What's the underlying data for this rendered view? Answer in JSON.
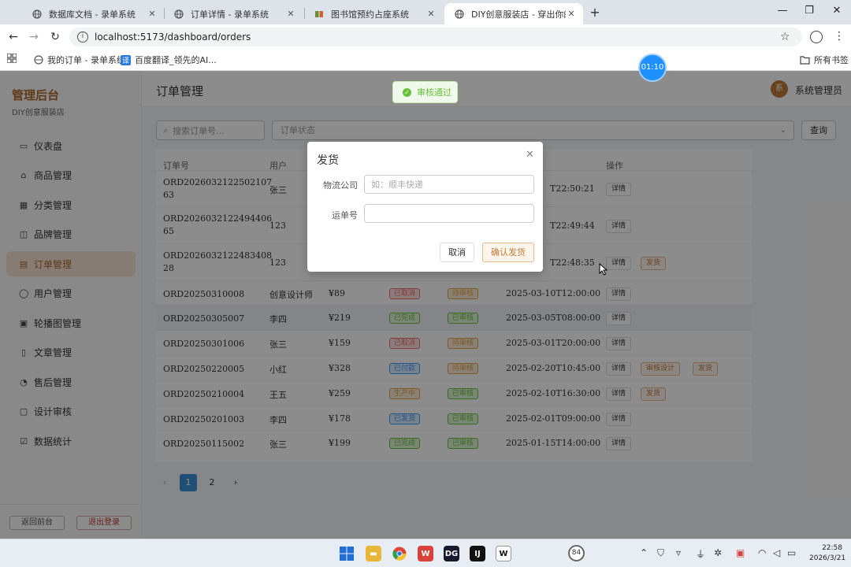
{
  "browser": {
    "tabs": [
      {
        "label": "数据库文档 - 录单系统",
        "active": false,
        "favicon": "globe-icon"
      },
      {
        "label": "订单详情 - 录单系统",
        "active": false,
        "favicon": "globe-icon"
      },
      {
        "label": "图书馆预约占座系统",
        "active": false,
        "favicon": "book-icon"
      },
      {
        "label": "DIY创意服装店 - 穿出你的故事",
        "active": true,
        "favicon": "globe-icon"
      }
    ],
    "url": "localhost:5173/dashboard/orders",
    "bookmarks": [
      {
        "label": "我的订单 - 录单系统"
      },
      {
        "label": "百度翻译_领先的AI..."
      }
    ],
    "all_bookmarks": "所有书签"
  },
  "sidebar": {
    "title": "管理后台",
    "subtitle": "DIY创意服装店",
    "items": [
      {
        "label": "仪表盘",
        "icon": "dashboard-icon"
      },
      {
        "label": "商品管理",
        "icon": "bag-icon"
      },
      {
        "label": "分类管理",
        "icon": "grid-icon"
      },
      {
        "label": "品牌管理",
        "icon": "brand-icon"
      },
      {
        "label": "订单管理",
        "icon": "order-icon",
        "active": true
      },
      {
        "label": "用户管理",
        "icon": "user-icon"
      },
      {
        "label": "轮播图管理",
        "icon": "image-icon"
      },
      {
        "label": "文章管理",
        "icon": "article-icon"
      },
      {
        "label": "售后管理",
        "icon": "service-icon"
      },
      {
        "label": "设计审核",
        "icon": "review-icon"
      },
      {
        "label": "数据统计",
        "icon": "chart-icon"
      }
    ],
    "back_label": "返回前台",
    "logout_label": "退出登录"
  },
  "header": {
    "title": "订单管理",
    "avatar_text": "系",
    "admin_name": "系统管理员"
  },
  "toast": "审核通过",
  "filters": {
    "search_placeholder": "搜索订单号...",
    "status_placeholder": "订单状态",
    "query_label": "查询"
  },
  "table": {
    "headers": [
      "订单号",
      "用户",
      "",
      "",
      "",
      "",
      "操作"
    ],
    "rows": [
      {
        "order_no": "ORD2026032122502107\n63",
        "user": "张三",
        "amount": "",
        "status": "",
        "review": "",
        "time": "T22:50:21",
        "actions": [
          "详情"
        ]
      },
      {
        "order_no": "ORD2026032122494406\n65",
        "user": "123",
        "amount": "",
        "status": "",
        "review": "",
        "time": "T22:49:44",
        "actions": [
          "详情"
        ]
      },
      {
        "order_no": "ORD2026032122483408\n28",
        "user": "123",
        "amount": "",
        "status": "",
        "review": "",
        "time": "T22:48:35",
        "actions": [
          "详情",
          "发货"
        ]
      },
      {
        "order_no": "ORD20250310008",
        "user": "创意设计师",
        "amount": "¥89",
        "status": "已取消",
        "review": "待审核",
        "time": "2025-03-10T12:00:00",
        "actions": [
          "详情"
        ]
      },
      {
        "order_no": "ORD20250305007",
        "user": "李四",
        "amount": "¥219",
        "status": "已完成",
        "review": "已审核",
        "time": "2025-03-05T08:00:00",
        "actions": [
          "详情"
        ]
      },
      {
        "order_no": "ORD20250301006",
        "user": "张三",
        "amount": "¥159",
        "status": "已取消",
        "review": "待审核",
        "time": "2025-03-01T20:00:00",
        "actions": [
          "详情"
        ]
      },
      {
        "order_no": "ORD20250220005",
        "user": "小红",
        "amount": "¥328",
        "status": "已付款",
        "review": "待审核",
        "time": "2025-02-20T10:45:00",
        "actions": [
          "详情",
          "审核设计",
          "发货"
        ]
      },
      {
        "order_no": "ORD20250210004",
        "user": "王五",
        "amount": "¥259",
        "status": "生产中",
        "review": "已审核",
        "time": "2025-02-10T16:30:00",
        "actions": [
          "详情",
          "发货"
        ]
      },
      {
        "order_no": "ORD20250201003",
        "user": "李四",
        "amount": "¥178",
        "status": "已发货",
        "review": "已审核",
        "time": "2025-02-01T09:00:00",
        "actions": [
          "详情"
        ]
      },
      {
        "order_no": "ORD20250115002",
        "user": "张三",
        "amount": "¥199",
        "status": "已完成",
        "review": "已审核",
        "time": "2025-01-15T14:00:00",
        "actions": [
          "详情"
        ]
      }
    ]
  },
  "pagination": {
    "prev": "‹",
    "pages": [
      "1",
      "2"
    ],
    "current": "1",
    "next": "›"
  },
  "modal": {
    "title": "发货",
    "company_label": "物流公司",
    "company_placeholder": "如：顺丰快递",
    "tracking_label": "运单号",
    "tracking_value": "",
    "cancel_label": "取消",
    "confirm_label": "确认发货"
  },
  "timer": "01:10",
  "taskbar": {
    "badge": "84",
    "time": "22:58",
    "date": "2026/3/21"
  },
  "colors": {
    "accent": "#b06a2c",
    "primary_blue": "#3b8fd6",
    "success": "#67c23a",
    "warning": "#e6a23c",
    "danger": "#f56c6c"
  }
}
